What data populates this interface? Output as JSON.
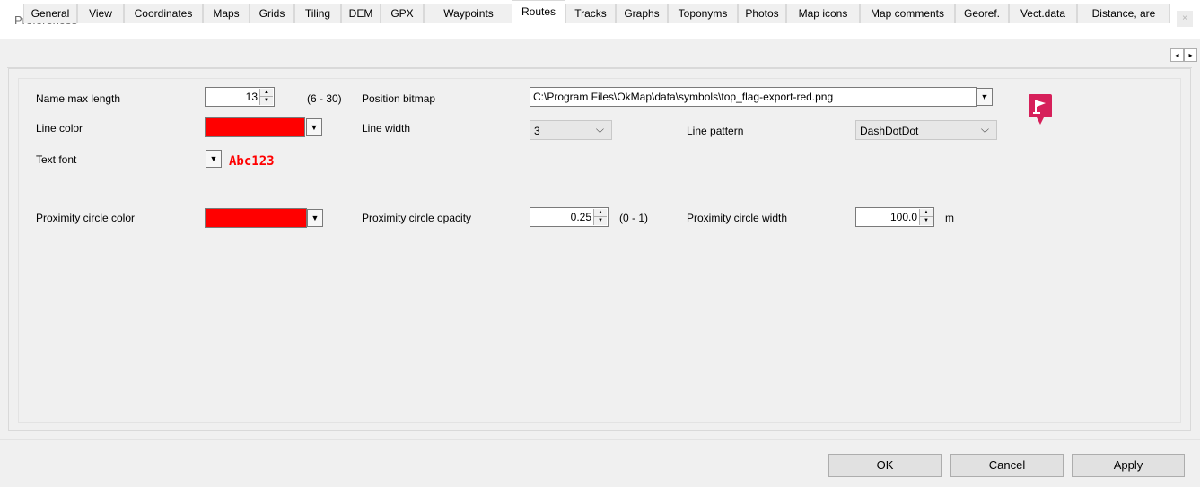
{
  "window": {
    "title": "Preferences",
    "close_label": "×"
  },
  "tabs": [
    "General",
    "View",
    "Coordinates",
    "Maps",
    "Grids",
    "Tiling",
    "DEM",
    "GPX",
    "Waypoints",
    "Routes",
    "Tracks",
    "Graphs",
    "Toponyms",
    "Photos",
    "Map icons",
    "Map comments",
    "Georef.",
    "Vect.data",
    "Distance, are"
  ],
  "active_tab": "Routes",
  "tab_scroll": {
    "left": "◂",
    "right": "▸"
  },
  "form": {
    "name_max_length": {
      "label": "Name max length",
      "value": "13",
      "range": "(6 - 30)"
    },
    "position_bitmap": {
      "label": "Position bitmap",
      "value": "C:\\Program Files\\OkMap\\data\\symbols\\top_flag-export-red.png"
    },
    "line_color": {
      "label": "Line color",
      "color": "#ff0000"
    },
    "line_width": {
      "label": "Line width",
      "value": "3"
    },
    "line_pattern": {
      "label": "Line pattern",
      "value": "DashDotDot"
    },
    "text_font": {
      "label": "Text font",
      "sample": "Abc123"
    },
    "proximity_circle_color": {
      "label": "Proximity circle color",
      "color": "#ff0000"
    },
    "proximity_circle_opacity": {
      "label": "Proximity circle opacity",
      "value": "0.25",
      "range": "(0 - 1)"
    },
    "proximity_circle_width": {
      "label": "Proximity circle width",
      "value": "100.0",
      "unit": "m"
    }
  },
  "icons": {
    "spin_up": "▲",
    "spin_down": "▼",
    "dropdown": "▼",
    "chevron": "⌵",
    "flag_color": "#d6205a"
  },
  "buttons": {
    "ok": "OK",
    "cancel": "Cancel",
    "apply": "Apply"
  }
}
